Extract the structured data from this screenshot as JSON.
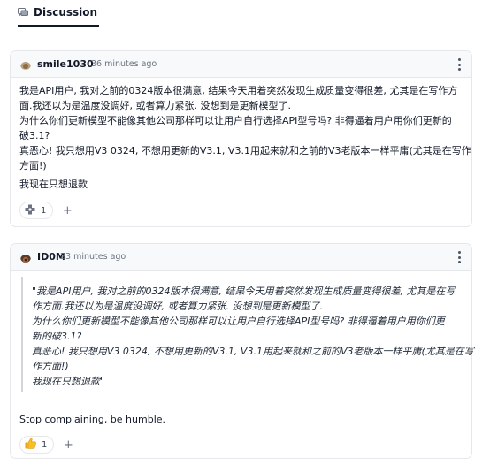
{
  "tab": {
    "label": "Discussion",
    "icon": "discussion-icon"
  },
  "comments": [
    {
      "username": "smile1030",
      "timestamp": "36 minutes ago",
      "body_lines": [
        "我是API用户, 我对之前的0324版本很满意, 结果今天用着突然发现生成质量变得很差, 尤其是在写作方",
        "面.我还以为是温度没调好, 或者算力紧张. 没想到是更新模型了.",
        "为什么你们更新模型不能像其他公司那样可以让用户自行选择API型号吗? 非得逼着用户用你们更新的",
        "破3.1?",
        "真恶心! 我只想用V3 0324, 不想用更新的V3.1, V3.1用起来就和之前的V3老版本一样平庸(尤其是在写作",
        "方面!)",
        "我现在只想退款"
      ],
      "reaction": {
        "icon": "puzzle-icon",
        "count": "1"
      },
      "add_reaction": "+"
    },
    {
      "username": "ID0M",
      "timestamp": "23 minutes ago",
      "quote_lines": [
        "\"我是API用户, 我对之前的0324版本很满意, 结果今天用着突然发现生成质量变得很差, 尤其是在写",
        "作方面.我还以为是温度没调好, 或者算力紧张. 没想到是更新模型了.",
        "为什么你们更新模型不能像其他公司那样可以让用户自行选择API型号吗? 非得逼着用户用你们更",
        "新的破3.1?",
        "真恶心! 我只想用V3 0324, 不想用更新的V3.1, V3.1用起来就和之前的V3老版本一样平庸(尤其是在写",
        "作方面!)",
        "我现在只想退款\""
      ],
      "body": "Stop complaining, be humble.",
      "reaction": {
        "icon": "thumbs-up-icon",
        "count": "1"
      },
      "add_reaction": "+"
    }
  ]
}
